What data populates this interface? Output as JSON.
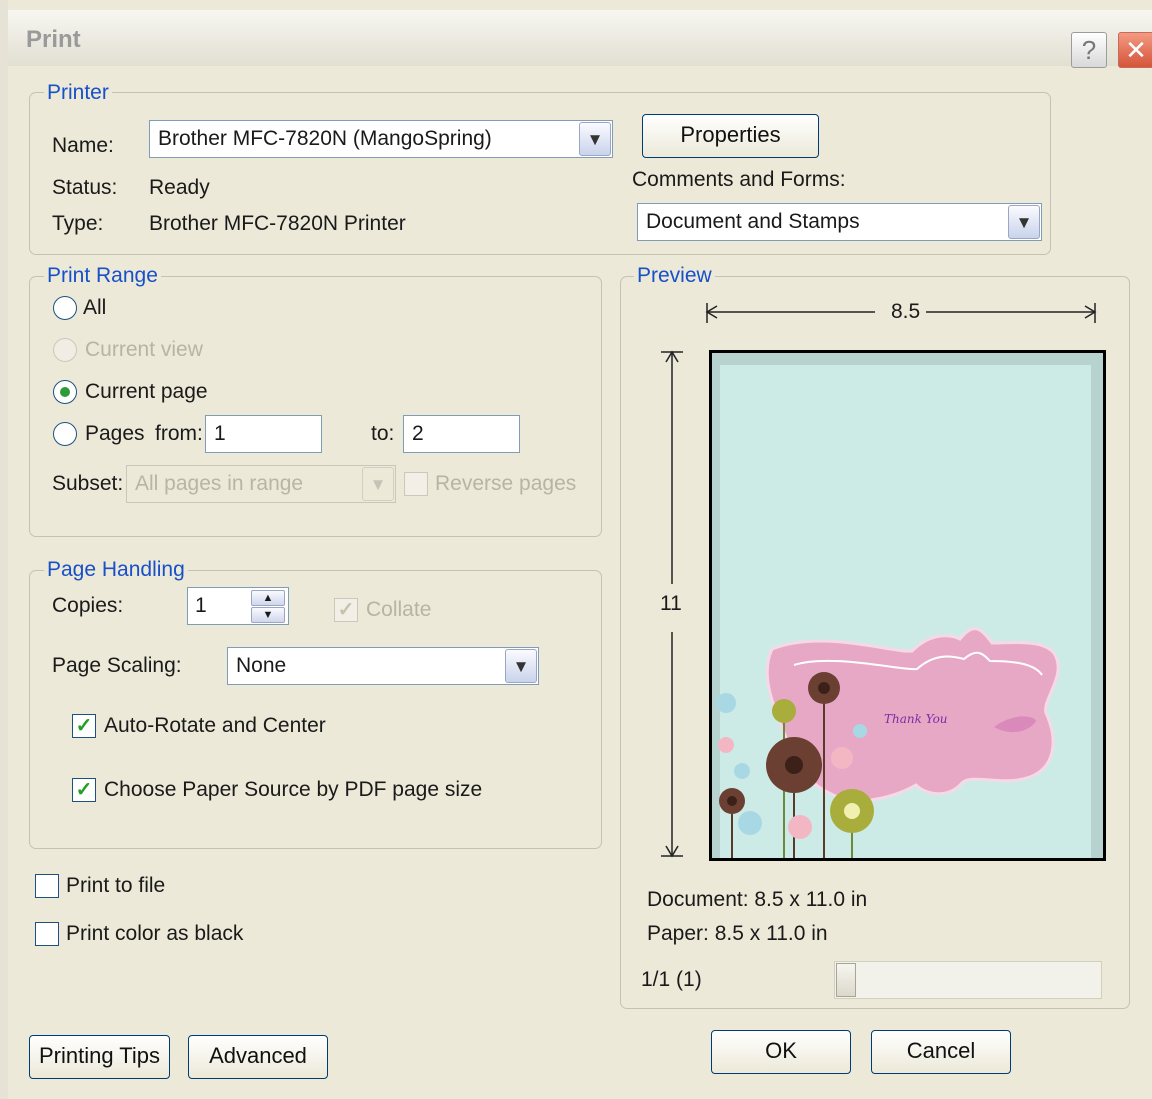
{
  "window": {
    "title": "Print"
  },
  "titlebar": {
    "help_glyph": "?",
    "close_glyph": "✕"
  },
  "printer": {
    "legend": "Printer",
    "name_label": "Name:",
    "name_value": "Brother MFC-7820N (MangoSpring)",
    "status_label": "Status:",
    "status_value": "Ready",
    "type_label": "Type:",
    "type_value": "Brother MFC-7820N Printer",
    "properties_button": "Properties",
    "comments_label": "Comments and Forms:",
    "comments_value": "Document and Stamps"
  },
  "print_range": {
    "legend": "Print Range",
    "all_label": "All",
    "current_view_label": "Current view",
    "current_page_label": "Current page",
    "pages_label": "Pages",
    "from_label": "from:",
    "from_value": "1",
    "to_label": "to:",
    "to_value": "2",
    "subset_label": "Subset:",
    "subset_value": "All pages in range",
    "reverse_label": "Reverse pages",
    "selected": "Current page"
  },
  "page_handling": {
    "legend": "Page Handling",
    "copies_label": "Copies:",
    "copies_value": "1",
    "collate_label": "Collate",
    "collate_checked": true,
    "scaling_label": "Page Scaling:",
    "scaling_value": "None",
    "auto_rotate_label": "Auto-Rotate and Center",
    "auto_rotate_checked": true,
    "paper_source_label": "Choose Paper Source by PDF page size",
    "paper_source_checked": true
  },
  "options": {
    "print_to_file_label": "Print to file",
    "print_to_file_checked": false,
    "color_as_black_label": "Print color as black",
    "color_as_black_checked": false
  },
  "preview": {
    "legend": "Preview",
    "width_label": "8.5",
    "height_label": "11",
    "card_text": "Thank You",
    "document_text": "Document: 8.5 x 11.0 in",
    "paper_text": "Paper: 8.5 x 11.0 in",
    "page_count": "1/1 (1)",
    "slider_position": 0
  },
  "buttons": {
    "printing_tips": "Printing Tips",
    "advanced": "Advanced",
    "ok": "OK",
    "cancel": "Cancel"
  },
  "colors": {
    "dialog_bg": "#ece9d8",
    "legend_text": "#1750c9",
    "page_bg": "#cdebe6",
    "card_pink": "#e7a8c6",
    "check_green": "#21a121"
  },
  "icons": {
    "dropdown": "chevron-down-icon",
    "spin_up": "spin-up-icon",
    "spin_down": "spin-down-icon",
    "check": "checkmark-icon"
  }
}
